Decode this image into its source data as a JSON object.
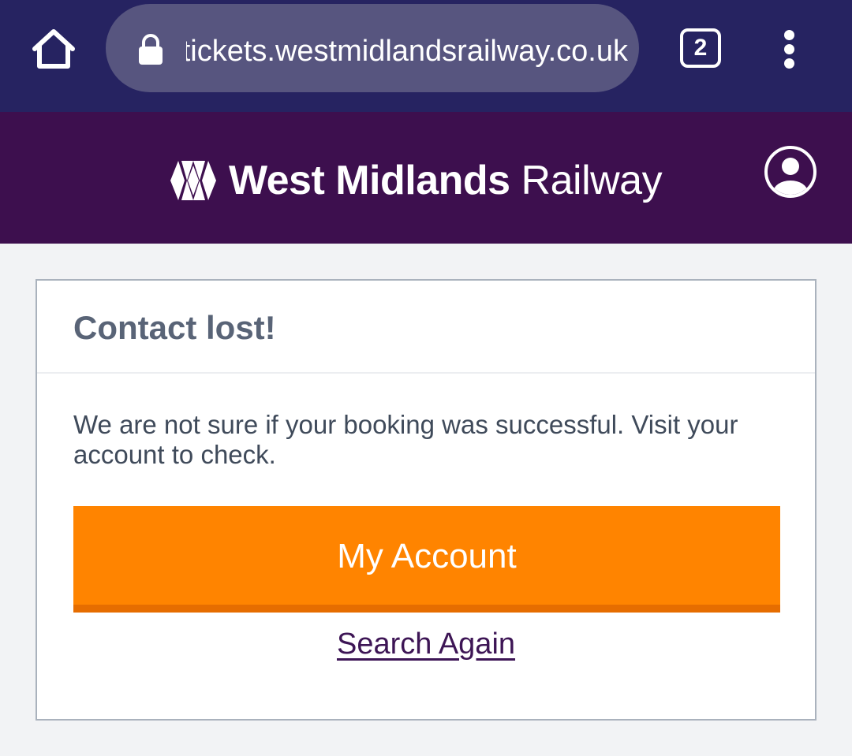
{
  "browser": {
    "url": "tickets.westmidlandsrailway.co.uk",
    "tab_count": "2"
  },
  "header": {
    "brand_bold": "West Midlands",
    "brand_regular": "Railway"
  },
  "dialog": {
    "title": "Contact lost!",
    "message": "We are not sure if your booking was successful. Visit your account to check.",
    "primary_button": "My Account",
    "secondary_link": "Search Again"
  },
  "colors": {
    "browser_bar": "#262361",
    "header_bg": "#3d0f4e",
    "accent_orange": "#ff8400",
    "link_purple": "#3d1555"
  }
}
